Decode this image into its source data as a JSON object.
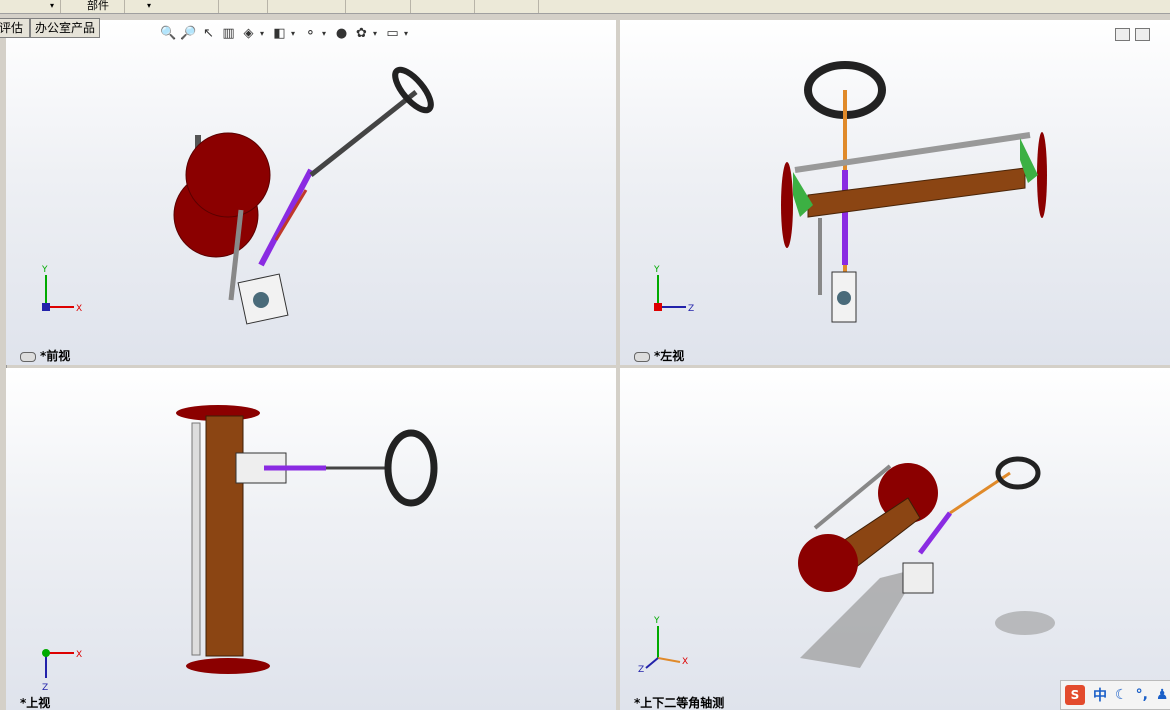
{
  "topbar": {
    "parts_label": "部件"
  },
  "tabs": [
    {
      "label": "评估"
    },
    {
      "label": "办公室产品"
    }
  ],
  "viewports": [
    {
      "label": "*前视"
    },
    {
      "label": "*左视"
    },
    {
      "label": "*上视"
    },
    {
      "label": "*上下二等角轴测"
    }
  ],
  "axes": {
    "front": {
      "h": "X",
      "v": "Y"
    },
    "left": {
      "h": "Z",
      "v": "Y"
    },
    "top": {
      "h": "X",
      "v": "Z"
    },
    "iso": {
      "h": "X",
      "v": "Y",
      "d": "Z"
    }
  },
  "ime": {
    "badge": "S",
    "lang": "中"
  },
  "colors": {
    "wheel": "#8b0000",
    "shaft": "#555555",
    "beam": "#8b4513",
    "joint": "#8a2be2",
    "bracket": "#3cb043"
  }
}
